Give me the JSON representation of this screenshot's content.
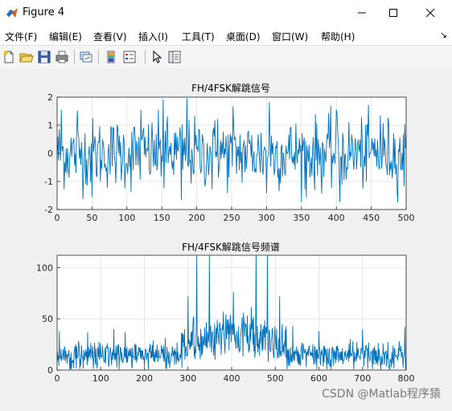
{
  "window": {
    "title": "Figure 4"
  },
  "menu": [
    "文件(F)",
    "编辑(E)",
    "查看(V)",
    "插入(I)",
    "工具(T)",
    "桌面(D)",
    "窗口(W)",
    "帮助(H)"
  ],
  "menu_overflow": "↘",
  "toolbar": [
    "new-figure",
    "open-file",
    "save-figure",
    "print-figure",
    "link-plot",
    "insert-colorbar",
    "insert-legend",
    "select-pointer",
    "property-inspector"
  ],
  "line_color": "#0072BD",
  "watermark": "CSDN @Matlab程序猿",
  "chart_data": [
    {
      "type": "line",
      "title": "FH/4FSK解跳信号",
      "xlim": [
        0,
        500
      ],
      "ylim": [
        -2,
        2
      ],
      "xticks": [
        0,
        50,
        100,
        150,
        200,
        250,
        300,
        350,
        400,
        450,
        500
      ],
      "yticks": [
        -2,
        -1,
        0,
        1,
        2
      ],
      "grid": true,
      "series": [
        {
          "x": [
            0,
            500
          ],
          "values": [
            0.2,
            -0.3
          ],
          "description_points": [
            [
              6,
              1.55
            ],
            [
              29,
              1.52
            ],
            [
              120,
              1.55
            ],
            [
              152,
              1.92
            ],
            [
              186,
              1.97
            ],
            [
              230,
              1.22
            ],
            [
              252,
              1.67
            ],
            [
              304,
              1.82
            ],
            [
              400,
              1.55
            ],
            [
              463,
              1.35
            ],
            [
              50,
              -1.55
            ],
            [
              106,
              -1.38
            ],
            [
              153,
              -1.25
            ],
            [
              178,
              -1.65
            ],
            [
              222,
              -1.28
            ],
            [
              300,
              -1.42
            ],
            [
              357,
              -1.58
            ],
            [
              405,
              -1.73
            ],
            [
              497,
              -1.18
            ]
          ]
        }
      ]
    },
    {
      "type": "line",
      "title": "FH/4FSK解跳信号频谱",
      "xlim": [
        0,
        800
      ],
      "ylim": [
        0,
        112
      ],
      "xticks": [
        0,
        100,
        200,
        300,
        400,
        500,
        600,
        700,
        800
      ],
      "yticks": [
        0,
        50,
        100
      ],
      "grid": true,
      "series": [
        {
          "x": [
            0,
            800
          ],
          "values": [
            15,
            15
          ],
          "description_points": [
            [
              5,
              38
            ],
            [
              70,
              37
            ],
            [
              130,
              40
            ],
            [
              285,
              36
            ],
            [
              300,
              72
            ],
            [
              320,
              112
            ],
            [
              349,
              112
            ],
            [
              404,
              76
            ],
            [
              456,
              112
            ],
            [
              482,
              112
            ],
            [
              510,
              72
            ],
            [
              540,
              43
            ],
            [
              600,
              38
            ],
            [
              700,
              40
            ],
            [
              797,
              42
            ]
          ]
        }
      ]
    }
  ]
}
